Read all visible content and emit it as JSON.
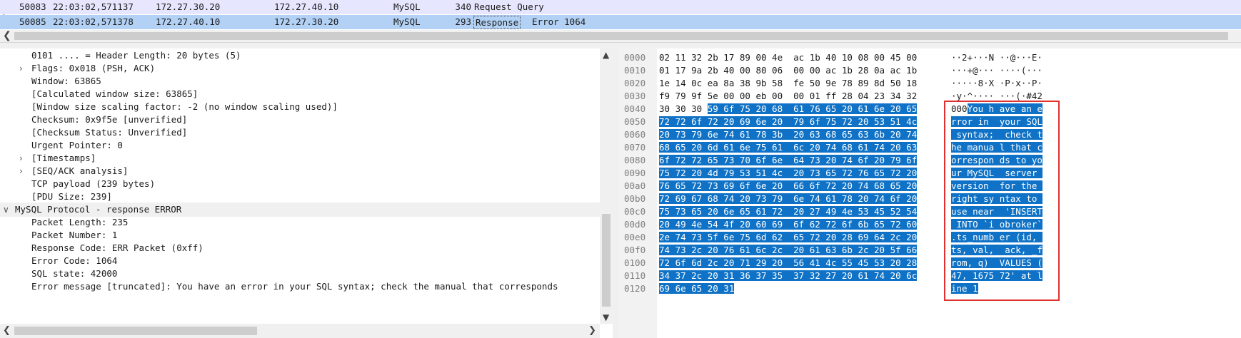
{
  "packet_list": {
    "rows": [
      {
        "no": "50083",
        "time": "22:03:02,571137",
        "src": "172.27.30.20",
        "dst": "172.27.40.10",
        "proto": "MySQL",
        "len": "340",
        "info": "Request Query"
      },
      {
        "no": "50085",
        "time": "22:03:02,571378",
        "src": "172.27.40.10",
        "dst": "172.27.30.20",
        "proto": "MySQL",
        "len": "293",
        "info_box": "Response",
        "info_rest": "Error 1064"
      }
    ],
    "scroll_left_icon": "chevron-left-icon"
  },
  "details": {
    "lines": [
      {
        "text": "0101 .... = Header Length: 20 bytes (5)",
        "indent": 2,
        "expander": ""
      },
      {
        "text": "Flags: 0x018 (PSH, ACK)",
        "indent": 2,
        "expander": "collapsed"
      },
      {
        "text": "Window: 63865",
        "indent": 2,
        "expander": ""
      },
      {
        "text": "[Calculated window size: 63865]",
        "indent": 2,
        "expander": ""
      },
      {
        "text": "[Window size scaling factor: -2 (no window scaling used)]",
        "indent": 2,
        "expander": ""
      },
      {
        "text": "Checksum: 0x9f5e [unverified]",
        "indent": 2,
        "expander": ""
      },
      {
        "text": "[Checksum Status: Unverified]",
        "indent": 2,
        "expander": ""
      },
      {
        "text": "Urgent Pointer: 0",
        "indent": 2,
        "expander": ""
      },
      {
        "text": "[Timestamps]",
        "indent": 2,
        "expander": "collapsed"
      },
      {
        "text": "[SEQ/ACK analysis]",
        "indent": 2,
        "expander": "collapsed"
      },
      {
        "text": "TCP payload (239 bytes)",
        "indent": 2,
        "expander": ""
      },
      {
        "text": "[PDU Size: 239]",
        "indent": 2,
        "expander": ""
      },
      {
        "text": "MySQL Protocol - response ERROR",
        "indent": 1,
        "expander": "expanded",
        "selected": true
      },
      {
        "text": "Packet Length: 235",
        "indent": 2,
        "expander": ""
      },
      {
        "text": "Packet Number: 1",
        "indent": 2,
        "expander": ""
      },
      {
        "text": "Response Code: ERR Packet (0xff)",
        "indent": 2,
        "expander": ""
      },
      {
        "text": "Error Code: 1064",
        "indent": 2,
        "expander": ""
      },
      {
        "text": "SQL state: 42000",
        "indent": 2,
        "expander": ""
      },
      {
        "text": "Error message [truncated]: You have an error in your SQL syntax; check the manual that corresponds",
        "indent": 2,
        "expander": ""
      }
    ]
  },
  "bytes": {
    "rows": [
      {
        "offset": "0000",
        "hex_plain": "02 11 32 2b 17 89 00 4e  ac 1b 40 10 08 00 45 00",
        "hex_hl": "",
        "ascii_plain": "··2+···N ··@···E·",
        "ascii_hl": ""
      },
      {
        "offset": "0010",
        "hex_plain": "01 17 9a 2b 40 00 80 06  00 00 ac 1b 28 0a ac 1b",
        "hex_hl": "",
        "ascii_plain": "···+@··· ····(···",
        "ascii_hl": ""
      },
      {
        "offset": "0020",
        "hex_plain": "1e 14 0c ea 8a 38 9b 58  fe 50 9e 78 89 8d 50 18",
        "hex_hl": "",
        "ascii_plain": "·····8·X ·P·x··P·",
        "ascii_hl": ""
      },
      {
        "offset": "0030",
        "hex_plain": "f9 79 9f 5e 00 00 eb 00  00 01 ff 28 04 23 34 32",
        "hex_hl": "",
        "ascii_plain": "·y·^···· ···(·#42",
        "ascii_hl": ""
      },
      {
        "offset": "0040",
        "hex_plain": "30 30 30 ",
        "hex_hl": "59 6f 75 20 68  61 76 65 20 61 6e 20 65",
        "ascii_plain": "000",
        "ascii_hl": "You h ave an e"
      },
      {
        "offset": "0050",
        "hex_plain": "",
        "hex_hl": "72 72 6f 72 20 69 6e 20  79 6f 75 72 20 53 51 4c",
        "ascii_plain": "",
        "ascii_hl": "rror in  your SQL"
      },
      {
        "offset": "0060",
        "hex_plain": "",
        "hex_hl": "20 73 79 6e 74 61 78 3b  20 63 68 65 63 6b 20 74",
        "ascii_plain": "",
        "ascii_hl": " syntax;  check t"
      },
      {
        "offset": "0070",
        "hex_plain": "",
        "hex_hl": "68 65 20 6d 61 6e 75 61  6c 20 74 68 61 74 20 63",
        "ascii_plain": "",
        "ascii_hl": "he manua l that c"
      },
      {
        "offset": "0080",
        "hex_plain": "",
        "hex_hl": "6f 72 72 65 73 70 6f 6e  64 73 20 74 6f 20 79 6f",
        "ascii_plain": "",
        "ascii_hl": "orrespon ds to yo"
      },
      {
        "offset": "0090",
        "hex_plain": "",
        "hex_hl": "75 72 20 4d 79 53 51 4c  20 73 65 72 76 65 72 20",
        "ascii_plain": "",
        "ascii_hl": "ur MySQL  server "
      },
      {
        "offset": "00a0",
        "hex_plain": "",
        "hex_hl": "76 65 72 73 69 6f 6e 20  66 6f 72 20 74 68 65 20",
        "ascii_plain": "",
        "ascii_hl": "version  for the "
      },
      {
        "offset": "00b0",
        "hex_plain": "",
        "hex_hl": "72 69 67 68 74 20 73 79  6e 74 61 78 20 74 6f 20",
        "ascii_plain": "",
        "ascii_hl": "right sy ntax to "
      },
      {
        "offset": "00c0",
        "hex_plain": "",
        "hex_hl": "75 73 65 20 6e 65 61 72  20 27 49 4e 53 45 52 54",
        "ascii_plain": "",
        "ascii_hl": "use near  'INSERT"
      },
      {
        "offset": "00d0",
        "hex_plain": "",
        "hex_hl": "20 49 4e 54 4f 20 60 69  6f 62 72 6f 6b 65 72 60",
        "ascii_plain": "",
        "ascii_hl": " INTO `i obroker`"
      },
      {
        "offset": "00e0",
        "hex_plain": "",
        "hex_hl": "2e 74 73 5f 6e 75 6d 62  65 72 20 28 69 64 2c 20",
        "ascii_plain": "",
        "ascii_hl": ".ts_numb er (id, "
      },
      {
        "offset": "00f0",
        "hex_plain": "",
        "hex_hl": "74 73 2c 20 76 61 6c 2c  20 61 63 6b 2c 20 5f 66",
        "ascii_plain": "",
        "ascii_hl": "ts, val,  ack, _f"
      },
      {
        "offset": "0100",
        "hex_plain": "",
        "hex_hl": "72 6f 6d 2c 20 71 29 20  56 41 4c 55 45 53 20 28",
        "ascii_plain": "",
        "ascii_hl": "rom, q)  VALUES ("
      },
      {
        "offset": "0110",
        "hex_plain": "",
        "hex_hl": "34 37 2c 20 31 36 37 35  37 32 27 20 61 74 20 6c",
        "ascii_plain": "",
        "ascii_hl": "47, 1675 72' at l"
      },
      {
        "offset": "0120",
        "hex_plain": "",
        "hex_hl": "69 6e 65 20 31",
        "ascii_plain": "",
        "ascii_hl": "ine 1"
      }
    ]
  },
  "scrollbar": {
    "up_icon": "▲",
    "down_icon": "▼",
    "left_icon": "❮",
    "right_icon": "❯"
  },
  "colors": {
    "selection_blue": "#0f72c6",
    "row_request": "#e7e6ff",
    "row_response": "#b2d1f5",
    "annotation_red": "#e03030"
  }
}
